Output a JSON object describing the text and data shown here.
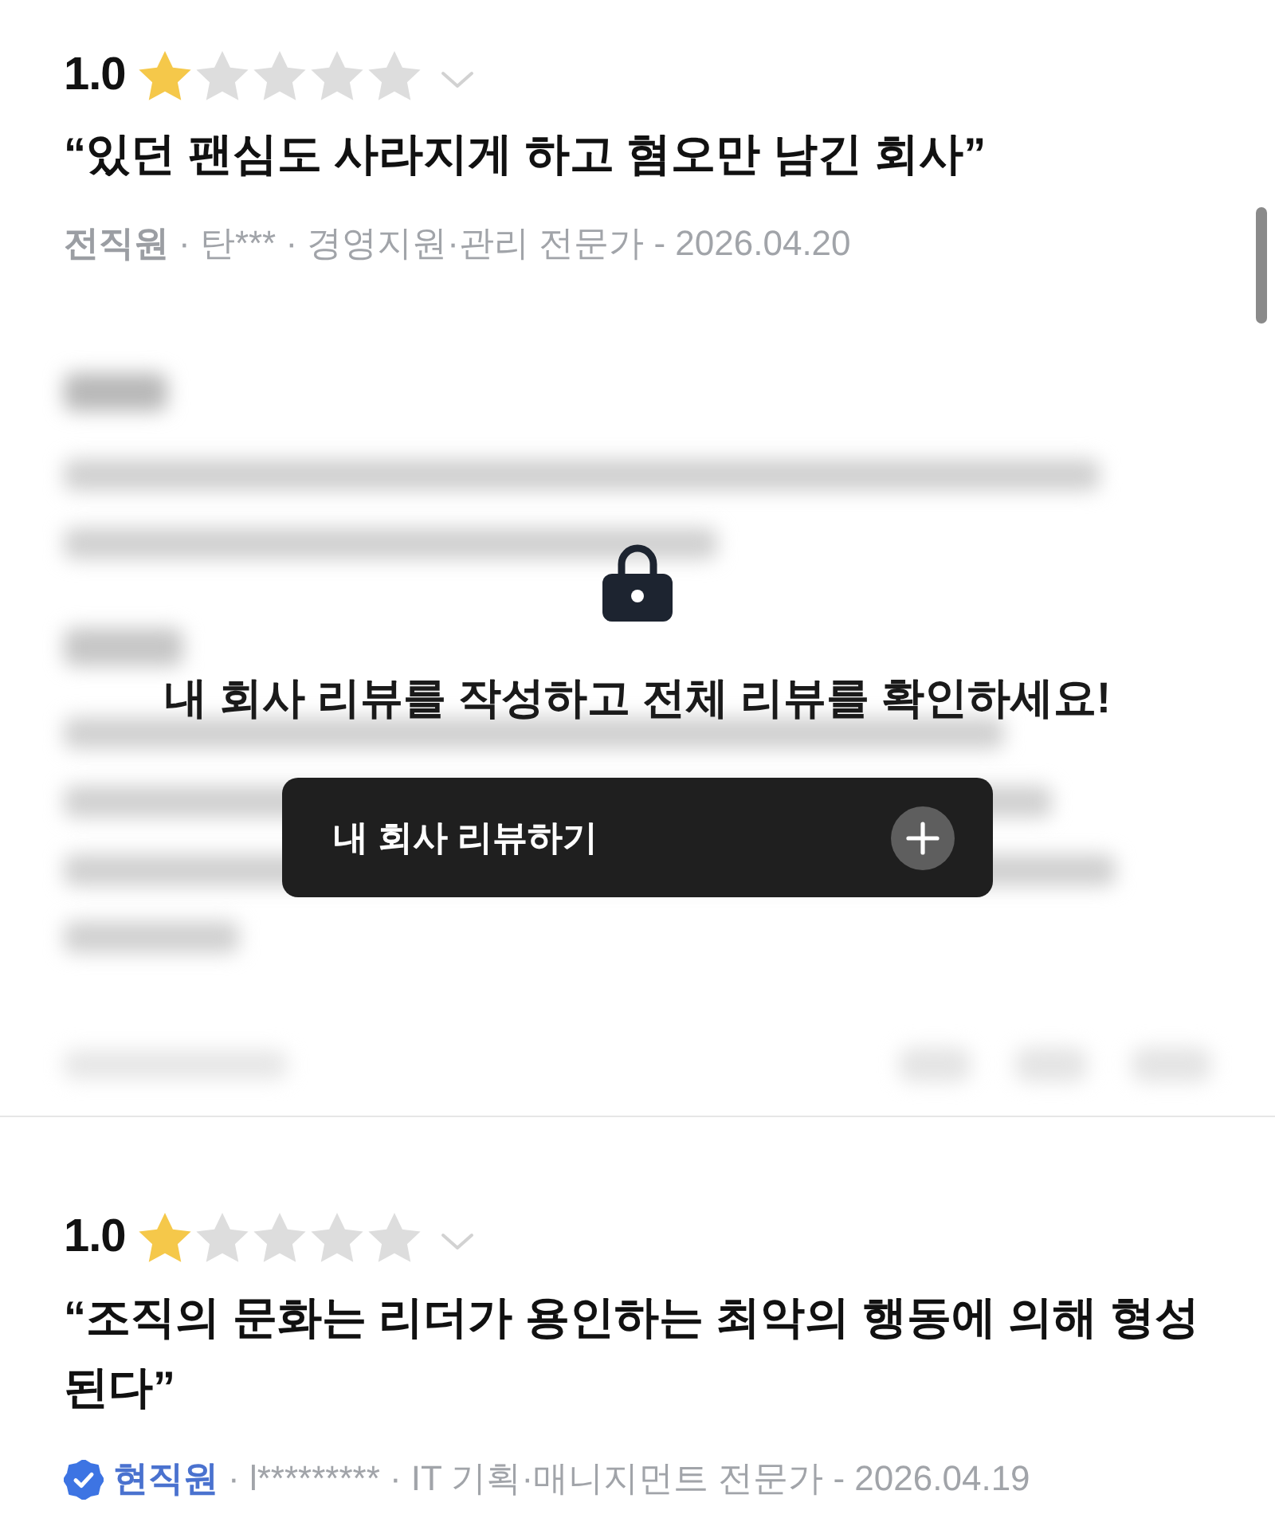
{
  "reviews": [
    {
      "rating": "1.0",
      "stars": 1,
      "title": "“있던 팬심도 사라지게 하고 혐오만 남긴 회사”",
      "status": "전직원",
      "verified": false,
      "meta": "· 탄*** · 경영지원·관리 전문가 - 2026.04.20",
      "lock_overlay": {
        "message": "내 회사 리뷰를 작성하고 전체 리뷰를 확인하세요!",
        "button": "내 회사 리뷰하기"
      }
    },
    {
      "rating": "1.0",
      "stars": 1,
      "title": "“조직의 문화는 리더가 용인하는 최악의 행동에 의해 형성된다”",
      "status": "현직원",
      "verified": true,
      "meta": "· l********* · IT 기획·매니지먼트 전문가 - 2026.04.19"
    }
  ]
}
